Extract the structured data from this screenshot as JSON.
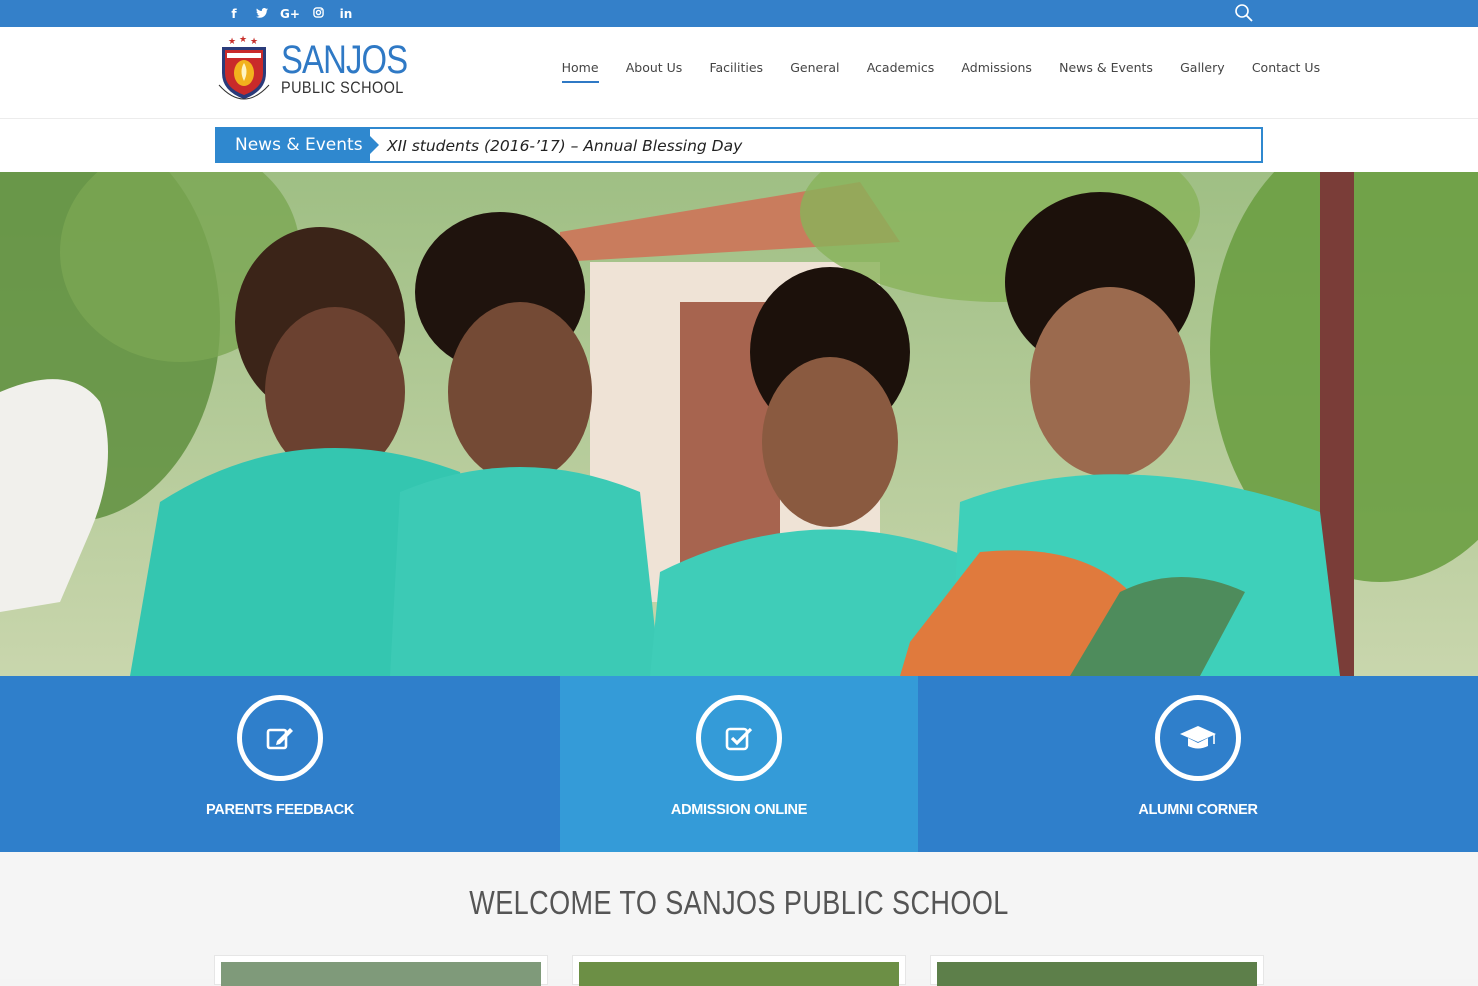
{
  "topbar": {
    "social": [
      {
        "icon": "facebook-icon",
        "glyph": "f"
      },
      {
        "icon": "twitter-icon",
        "glyph": "t"
      },
      {
        "icon": "google-plus-icon",
        "glyph": "G+"
      },
      {
        "icon": "instagram-icon",
        "glyph": "◎"
      },
      {
        "icon": "linkedin-icon",
        "glyph": "in"
      }
    ],
    "search_icon": "search-icon",
    "color": "#3480c9"
  },
  "header": {
    "logo": {
      "name": "SANJOS",
      "sub": "PUBLIC SCHOOL",
      "crest_text": "SANJOS PUBLIC SCHOOL"
    },
    "nav": [
      {
        "label": "Home",
        "active": true
      },
      {
        "label": "About Us"
      },
      {
        "label": "Facilities"
      },
      {
        "label": "General"
      },
      {
        "label": "Academics"
      },
      {
        "label": "Admissions"
      },
      {
        "label": "News & Events"
      },
      {
        "label": "Gallery"
      },
      {
        "label": "Contact Us"
      }
    ],
    "accent": "#2f79c5"
  },
  "ticker": {
    "label": "News & Events",
    "text": "XII students (2016-’17) – Annual Blessing Day"
  },
  "features": [
    {
      "label": "PARENTS FEEDBACK",
      "icon": "edit-icon",
      "color": "#2f7fcb"
    },
    {
      "label": "ADMISSION ONLINE",
      "icon": "checkbox-icon",
      "color": "#349bd8"
    },
    {
      "label": "ALUMNI CORNER",
      "icon": "graduation-cap-icon",
      "color": "#2f7fcb"
    }
  ],
  "welcome": {
    "title": "WELCOME TO SANJOS PUBLIC SCHOOL"
  }
}
